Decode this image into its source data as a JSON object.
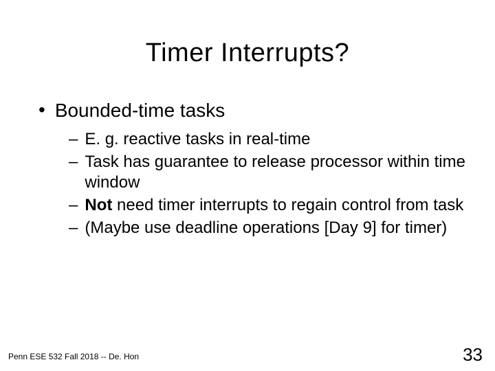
{
  "title": "Timer Interrupts?",
  "bullets": {
    "main": "Bounded-time tasks",
    "subs": {
      "s0": "E. g. reactive tasks in real-time",
      "s1": "Task has guarantee to release processor within time window",
      "s2_bold": "Not",
      "s2_rest": " need timer interrupts to regain control from task",
      "s3": "(Maybe use deadline operations [Day 9] for timer)"
    }
  },
  "footer": "Penn ESE 532 Fall 2018 -- De. Hon",
  "page": "33"
}
